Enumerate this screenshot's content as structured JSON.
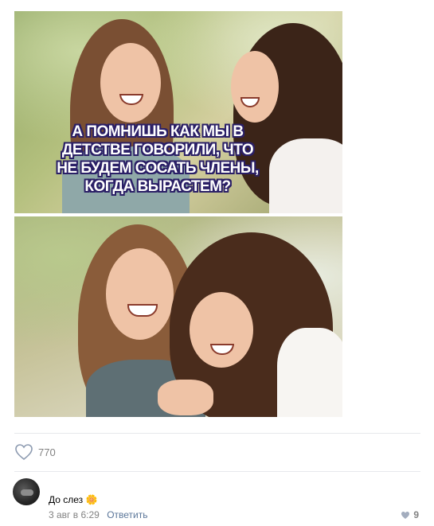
{
  "post": {
    "image": {
      "caption_lines": [
        "А ПОМНИШЬ КАК МЫ В",
        "ДЕТСТВЕ ГОВОРИЛИ, ЧТО",
        "НЕ БУДЕМ СОСАТЬ ЧЛЕНЫ,",
        "КОГДА ВЫРАСТЕМ?"
      ]
    },
    "likes": {
      "icon": "heart-outline-icon",
      "count": "770"
    }
  },
  "comment": {
    "author": "До слез 🌼",
    "date": "3 авг в 6:29",
    "reply_label": "Ответить",
    "likes_icon": "heart-icon",
    "likes_count": "9"
  },
  "colors": {
    "caption_outline": "#2a1f66",
    "meta_text": "#828282",
    "link": "#5b7699",
    "divider": "#e7e8ec"
  }
}
